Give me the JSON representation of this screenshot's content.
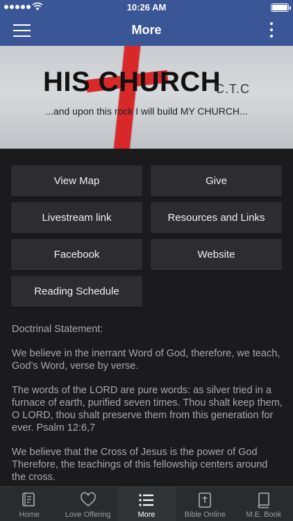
{
  "status_bar": {
    "time": "10:26 AM"
  },
  "nav": {
    "title": "More"
  },
  "banner": {
    "headline": "HIS CHURCH",
    "suffix": "C.T.C",
    "tagline": "...and upon this rock I will build MY CHURCH...",
    "cross_color": "#d8282a"
  },
  "buttons": [
    {
      "label": "View Map"
    },
    {
      "label": "Give"
    },
    {
      "label": "Livestream link"
    },
    {
      "label": "Resources and Links"
    },
    {
      "label": "Facebook"
    },
    {
      "label": "Website"
    },
    {
      "label": "Reading Schedule"
    }
  ],
  "statement": {
    "heading": "Doctrinal Statement:",
    "paragraphs": [
      "We believe in the inerrant Word of God, therefore, we teach, God’s Word, verse by verse.",
      "The words of the LORD are pure words: as silver tried in a furnace of earth, purified seven times. Thou shalt keep them, O LORD, thou shalt preserve them from this generation for ever. Psalm 12:6,7",
      "We believe that the Cross of Jesus is the power of God Therefore, the teachings of this fellowship centers around the cross."
    ]
  },
  "tabs": [
    {
      "label": "Home",
      "icon": "book-icon"
    },
    {
      "label": "Love Offering",
      "icon": "heart-icon"
    },
    {
      "label": "More",
      "icon": "list-icon",
      "active": true
    },
    {
      "label": "Bible Online",
      "icon": "bible-icon"
    },
    {
      "label": "M.E. Book",
      "icon": "book-closed-icon"
    }
  ],
  "colors": {
    "header": "#3a5696",
    "background": "#1b1b1d",
    "button": "#2d2d2f",
    "text_muted": "#a7a8ad"
  }
}
